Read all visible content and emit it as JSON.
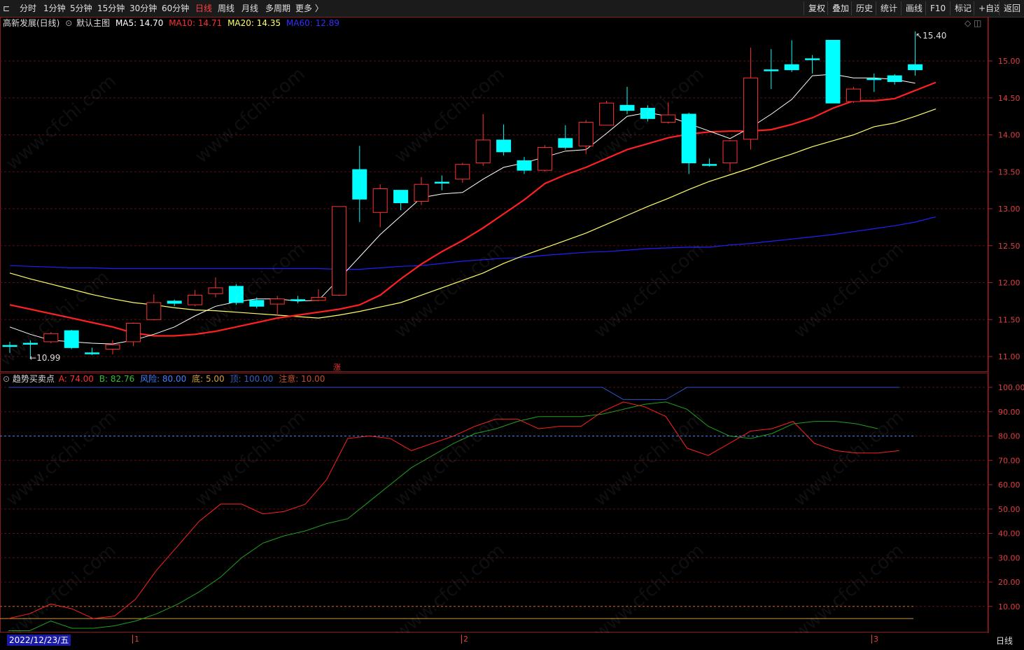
{
  "toolbar": {
    "left_icon": "⊏",
    "periods": [
      "分时",
      "1分钟",
      "5分钟",
      "15分钟",
      "30分钟",
      "60分钟",
      "日线",
      "周线",
      "月线",
      "多周期",
      "更多 〉"
    ],
    "active_period": "日线",
    "right_buttons": [
      "复权",
      "叠加",
      "历史",
      "统计",
      "画线",
      "F10",
      "标记",
      "+自选",
      "返回"
    ]
  },
  "main_panel": {
    "stock_name": "高新发展(日线)",
    "template": "默认主图",
    "ma5_label": "MA5: 14.70",
    "ma10_label": "MA10: 14.71",
    "ma20_label": "MA20: 14.35",
    "ma60_label": "MA60: 12.89",
    "high_marker": "15.40",
    "low_marker": "10.99",
    "limit_up_mark": "涨",
    "y_ticks": [
      "15.00",
      "14.50",
      "14.00",
      "13.50",
      "13.00",
      "12.50",
      "12.00",
      "11.50",
      "11.00"
    ]
  },
  "indicator_panel": {
    "name": "趋势买卖点",
    "a_label": "A: 74.00",
    "b_label": "B: 82.76",
    "risk_label": "风险: 80.00",
    "bottom_label": "底: 5.00",
    "top_label": "顶: 100.00",
    "caution_label": "注意: 10.00",
    "y_ticks": [
      "100.00",
      "90.00",
      "80.00",
      "70.00",
      "60.00",
      "50.00",
      "40.00",
      "30.00",
      "20.00",
      "10.00"
    ]
  },
  "time_axis": {
    "cursor_date": "2022/12/23/五",
    "month_marks": [
      "1",
      "2",
      "3"
    ],
    "period_label": "日线"
  },
  "colors": {
    "up": "#ff3232",
    "down": "#00ffff",
    "ma5": "#ffffff",
    "ma10": "#ff2020",
    "ma20": "#ffff66",
    "ma60": "#2020ff",
    "axis": "#e04040"
  },
  "chart_data": {
    "type": "candlestick",
    "candles": [
      {
        "o": 11.15,
        "c": 11.15,
        "h": 11.2,
        "l": 11.05
      },
      {
        "o": 11.18,
        "c": 11.18,
        "h": 11.22,
        "l": 10.99
      },
      {
        "o": 11.2,
        "c": 11.31,
        "h": 11.33,
        "l": 11.18
      },
      {
        "o": 11.35,
        "c": 11.12,
        "h": 11.36,
        "l": 11.1
      },
      {
        "o": 11.05,
        "c": 11.05,
        "h": 11.12,
        "l": 11.02
      },
      {
        "o": 11.1,
        "c": 11.16,
        "h": 11.22,
        "l": 11.03
      },
      {
        "o": 11.2,
        "c": 11.45,
        "h": 11.46,
        "l": 11.14
      },
      {
        "o": 11.5,
        "c": 11.73,
        "h": 11.84,
        "l": 11.49
      },
      {
        "o": 11.75,
        "c": 11.72,
        "h": 11.77,
        "l": 11.68
      },
      {
        "o": 11.7,
        "c": 11.83,
        "h": 11.9,
        "l": 11.68
      },
      {
        "o": 11.85,
        "c": 11.93,
        "h": 12.07,
        "l": 11.8
      },
      {
        "o": 11.95,
        "c": 11.73,
        "h": 11.98,
        "l": 11.7
      },
      {
        "o": 11.76,
        "c": 11.68,
        "h": 11.8,
        "l": 11.65
      },
      {
        "o": 11.71,
        "c": 11.78,
        "h": 11.82,
        "l": 11.55
      },
      {
        "o": 11.77,
        "c": 11.77,
        "h": 11.82,
        "l": 11.72
      },
      {
        "o": 11.76,
        "c": 11.8,
        "h": 11.91,
        "l": 11.75
      },
      {
        "o": 11.83,
        "c": 13.03,
        "h": 13.03,
        "l": 11.82
      },
      {
        "o": 13.53,
        "c": 13.13,
        "h": 13.85,
        "l": 12.82
      },
      {
        "o": 12.95,
        "c": 13.27,
        "h": 13.33,
        "l": 12.75
      },
      {
        "o": 13.25,
        "c": 13.08,
        "h": 13.25,
        "l": 12.98
      },
      {
        "o": 13.1,
        "c": 13.33,
        "h": 13.43,
        "l": 13.05
      },
      {
        "o": 13.36,
        "c": 13.36,
        "h": 13.45,
        "l": 13.25
      },
      {
        "o": 13.4,
        "c": 13.6,
        "h": 13.62,
        "l": 13.35
      },
      {
        "o": 13.62,
        "c": 13.93,
        "h": 14.28,
        "l": 13.58
      },
      {
        "o": 13.93,
        "c": 13.77,
        "h": 14.14,
        "l": 13.72
      },
      {
        "o": 13.65,
        "c": 13.52,
        "h": 13.7,
        "l": 13.47
      },
      {
        "o": 13.52,
        "c": 13.83,
        "h": 13.86,
        "l": 13.5
      },
      {
        "o": 13.95,
        "c": 13.83,
        "h": 14.13,
        "l": 13.8
      },
      {
        "o": 13.85,
        "c": 14.17,
        "h": 14.2,
        "l": 13.74
      },
      {
        "o": 14.13,
        "c": 14.43,
        "h": 14.46,
        "l": 14.13
      },
      {
        "o": 14.4,
        "c": 14.33,
        "h": 14.65,
        "l": 14.28
      },
      {
        "o": 14.36,
        "c": 14.22,
        "h": 14.4,
        "l": 14.18
      },
      {
        "o": 14.17,
        "c": 14.27,
        "h": 14.44,
        "l": 14.15
      },
      {
        "o": 14.28,
        "c": 13.62,
        "h": 14.3,
        "l": 13.47
      },
      {
        "o": 13.6,
        "c": 13.6,
        "h": 13.68,
        "l": 13.57
      },
      {
        "o": 13.62,
        "c": 13.92,
        "h": 13.93,
        "l": 13.5
      },
      {
        "o": 13.94,
        "c": 14.77,
        "h": 15.18,
        "l": 13.8
      },
      {
        "o": 14.88,
        "c": 14.88,
        "h": 15.16,
        "l": 14.62
      },
      {
        "o": 14.95,
        "c": 14.88,
        "h": 15.28,
        "l": 14.85
      },
      {
        "o": 15.03,
        "c": 15.03,
        "h": 15.08,
        "l": 14.83
      },
      {
        "o": 15.28,
        "c": 14.43,
        "h": 15.28,
        "l": 14.43
      },
      {
        "o": 14.45,
        "c": 14.62,
        "h": 14.65,
        "l": 14.43
      },
      {
        "o": 14.76,
        "c": 14.76,
        "h": 14.83,
        "l": 14.58
      },
      {
        "o": 14.8,
        "c": 14.72,
        "h": 14.82,
        "l": 14.68
      },
      {
        "o": 14.95,
        "c": 14.88,
        "h": 15.4,
        "l": 14.8
      }
    ],
    "ma5": [
      11.4,
      11.3,
      11.22,
      11.2,
      11.18,
      11.17,
      11.22,
      11.3,
      11.4,
      11.55,
      11.68,
      11.74,
      11.78,
      11.78,
      11.75,
      11.76,
      12.05,
      12.35,
      12.65,
      12.9,
      13.15,
      13.2,
      13.22,
      13.4,
      13.56,
      13.62,
      13.7,
      13.78,
      13.8,
      14.02,
      14.25,
      14.3,
      14.25,
      14.15,
      14.05,
      13.95,
      14.1,
      14.28,
      14.48,
      14.8,
      14.82,
      14.77,
      14.77,
      14.75,
      14.7
    ],
    "ma10": [
      11.7,
      11.64,
      11.58,
      11.52,
      11.46,
      11.4,
      11.32,
      11.28,
      11.28,
      11.3,
      11.34,
      11.4,
      11.46,
      11.52,
      11.56,
      11.6,
      11.64,
      11.7,
      11.83,
      12.05,
      12.25,
      12.42,
      12.57,
      12.74,
      12.93,
      13.12,
      13.34,
      13.46,
      13.56,
      13.68,
      13.8,
      13.88,
      13.96,
      14.01,
      14.04,
      14.05,
      14.05,
      14.07,
      14.14,
      14.23,
      14.36,
      14.46,
      14.46,
      14.49,
      14.6,
      14.71
    ],
    "ma20": [
      12.13,
      12.05,
      11.98,
      11.91,
      11.84,
      11.78,
      11.73,
      11.7,
      11.66,
      11.63,
      11.62,
      11.6,
      11.58,
      11.56,
      11.54,
      11.52,
      11.56,
      11.61,
      11.67,
      11.73,
      11.83,
      11.93,
      12.03,
      12.13,
      12.26,
      12.37,
      12.47,
      12.57,
      12.67,
      12.79,
      12.91,
      13.03,
      13.14,
      13.26,
      13.37,
      13.46,
      13.55,
      13.65,
      13.74,
      13.84,
      13.92,
      14.0,
      14.11,
      14.16,
      14.25,
      14.35
    ],
    "ma60": [
      12.23,
      12.22,
      12.21,
      12.2,
      12.2,
      12.19,
      12.19,
      12.19,
      12.19,
      12.19,
      12.19,
      12.19,
      12.19,
      12.19,
      12.19,
      12.19,
      12.18,
      12.18,
      12.2,
      12.22,
      12.23,
      12.26,
      12.29,
      12.31,
      12.33,
      12.34,
      12.37,
      12.39,
      12.41,
      12.42,
      12.44,
      12.46,
      12.47,
      12.48,
      12.48,
      12.51,
      12.53,
      12.56,
      12.59,
      12.62,
      12.65,
      12.69,
      12.73,
      12.77,
      12.82,
      12.89
    ],
    "ind_A": [
      5,
      7,
      11,
      9,
      5,
      6,
      13,
      25,
      35,
      45,
      52,
      52,
      48,
      49,
      52,
      62,
      79,
      80,
      79,
      74,
      77,
      80,
      84,
      87,
      87,
      83,
      84,
      84,
      90,
      94,
      92,
      88,
      75,
      72,
      77,
      82,
      83,
      86,
      77,
      74,
      73,
      73,
      74
    ],
    "ind_B": [
      0,
      0,
      4,
      1,
      1,
      2,
      4,
      7,
      11,
      16,
      22,
      30,
      36,
      39,
      41,
      44,
      46,
      53,
      60,
      67,
      72,
      77,
      81,
      83,
      86,
      88,
      88,
      88,
      89,
      91,
      93,
      94,
      91,
      84,
      80,
      79,
      81,
      85,
      86,
      86,
      85,
      83
    ],
    "ind_top": [
      100,
      100,
      100,
      100,
      100,
      100,
      100,
      100,
      100,
      100,
      100,
      100,
      100,
      100,
      100,
      100,
      100,
      100,
      100,
      100,
      100,
      100,
      100,
      100,
      100,
      100,
      100,
      100,
      100,
      95,
      95,
      95,
      100,
      100,
      100,
      100,
      100,
      100,
      100,
      100,
      100,
      100,
      100
    ],
    "risk": 80,
    "bottom": 5,
    "caution": 10,
    "ylim_main": [
      10.95,
      15.55
    ],
    "ylim_ind": [
      0,
      103
    ]
  }
}
